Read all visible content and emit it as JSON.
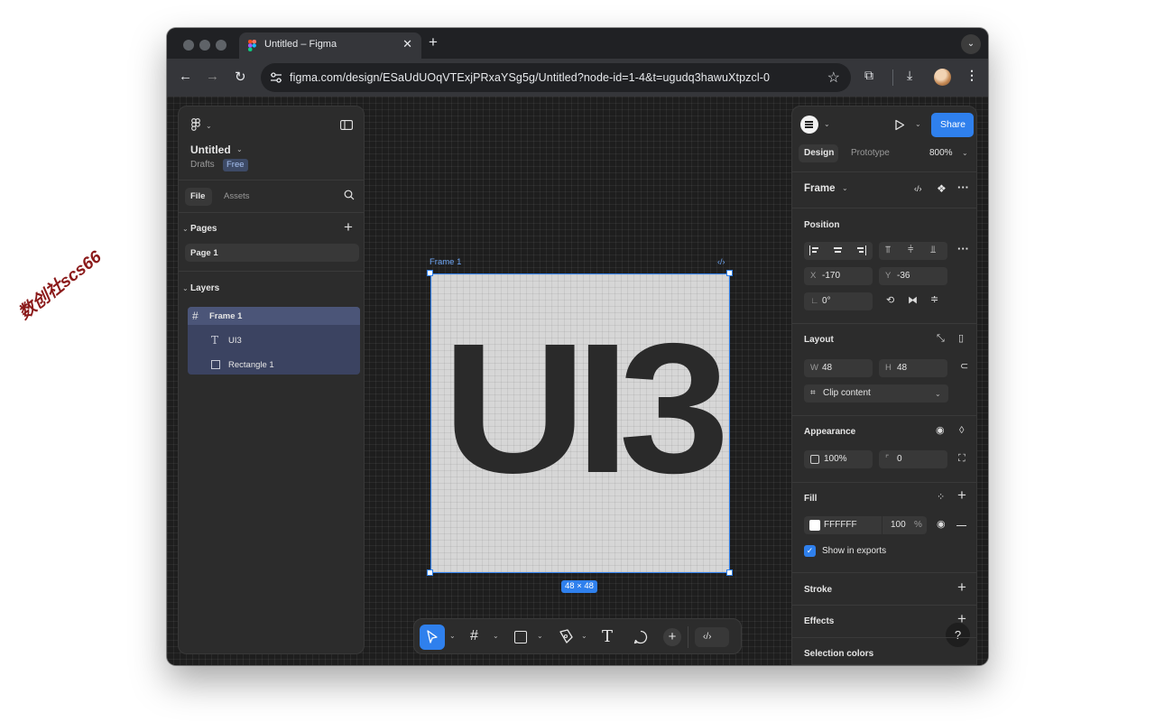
{
  "watermark": "数创社scs66",
  "browser": {
    "tab_title": "Untitled – Figma",
    "tab_close": "✕",
    "new_tab": "+",
    "url": "figma.com/design/ESaUdUOqVTExjPRxaYSg5g/Untitled?node-id=1-4&t=ugudq3hawuXtpzcl-0"
  },
  "left_panel": {
    "file_name": "Untitled",
    "location": "Drafts",
    "plan_badge": "Free",
    "tabs": [
      "File",
      "Assets"
    ],
    "pages_header": "Pages",
    "pages": [
      "Page 1"
    ],
    "layers_header": "Layers",
    "layers": [
      {
        "name": "Frame 1",
        "icon": "frame-icon"
      },
      {
        "name": "UI3",
        "icon": "text-icon"
      },
      {
        "name": "Rectangle 1",
        "icon": "rectangle-icon"
      }
    ]
  },
  "canvas": {
    "frame_label": "Frame 1",
    "frame_text": "UI3",
    "size_badge": "48 × 48",
    "code_glyph": "‹/›"
  },
  "right_panel": {
    "share_label": "Share",
    "tabs": [
      "Design",
      "Prototype"
    ],
    "zoom": "800%",
    "selection_type": "Frame",
    "position": {
      "title": "Position",
      "x": "-170",
      "y": "-36",
      "rotation": "0°",
      "x_label": "X",
      "y_label": "Y"
    },
    "layout": {
      "title": "Layout",
      "w": "48",
      "h": "48",
      "w_label": "W",
      "h_label": "H",
      "clip": "Clip content"
    },
    "appearance": {
      "title": "Appearance",
      "opacity": "100%",
      "radius": "0"
    },
    "fill": {
      "title": "Fill",
      "hex": "FFFFFF",
      "opacity": "100",
      "pct": "%",
      "show_in_exports": "Show in exports"
    },
    "stroke_title": "Stroke",
    "effects_title": "Effects",
    "selection_colors_title": "Selection colors",
    "help": "?"
  },
  "colors": {
    "accent": "#2f80ed",
    "panel": "#2c2c2c",
    "canvas": "#1e1e1e",
    "frame_fill": "#d6d6d6"
  }
}
